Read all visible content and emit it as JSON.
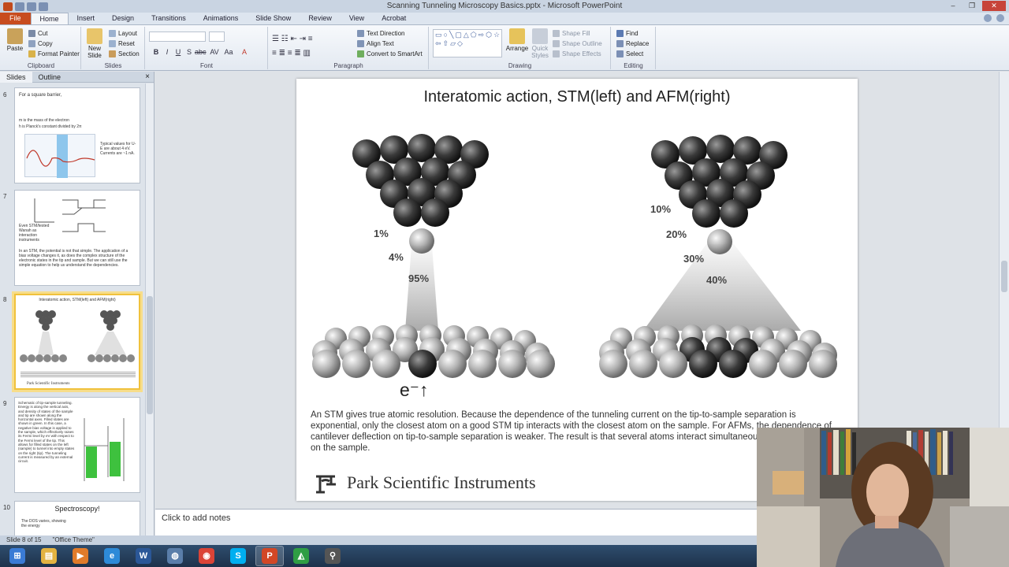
{
  "window": {
    "title": "Scanning Tunneling Microscopy Basics.pptx - Microsoft PowerPoint",
    "controls": [
      "–",
      "❐",
      "✕"
    ]
  },
  "ribbon_tabs": [
    "File",
    "Home",
    "Insert",
    "Design",
    "Transitions",
    "Animations",
    "Slide Show",
    "Review",
    "View",
    "Acrobat"
  ],
  "ribbon": {
    "clipboard": {
      "paste": "Paste",
      "cut": "Cut",
      "copy": "Copy",
      "format_painter": "Format Painter",
      "label": "Clipboard"
    },
    "slides": {
      "new_slide": "New Slide",
      "layout": "Layout",
      "reset": "Reset",
      "section": "Section",
      "label": "Slides"
    },
    "font": {
      "label": "Font",
      "buttons": [
        "B",
        "I",
        "U",
        "S",
        "abc",
        "AV",
        "Aa",
        "A"
      ]
    },
    "paragraph": {
      "label": "Paragraph",
      "text_direction": "Text Direction",
      "align_text": "Align Text",
      "smartart": "Convert to SmartArt"
    },
    "drawing": {
      "label": "Drawing",
      "arrange": "Arrange",
      "quick_styles": "Quick Styles",
      "shape_fill": "Shape Fill",
      "shape_outline": "Shape Outline",
      "shape_effects": "Shape Effects"
    },
    "editing": {
      "label": "Editing",
      "find": "Find",
      "replace": "Replace",
      "select": "Select"
    }
  },
  "panel": {
    "tabs": [
      "Slides",
      "Outline"
    ],
    "close": "×",
    "slides": [
      {
        "num": "6",
        "lines": [
          "For a square barrier,",
          "m is the mass of the electron",
          "h is Planck's constant divided by 2π",
          "Typical values for U-E are about 4 eV. Currents are ~1 nA."
        ]
      },
      {
        "num": "7",
        "lines": [
          "Even STM/tested Wanah as interaction instruments",
          "In an STM, the potential is not that simple. The application of a bias voltage changes it, as does the complex structure of the electronic states in the tip and sample. But we can still use the simple equation to help us understand the dependencies."
        ]
      },
      {
        "num": "8",
        "lines": [
          "Interatomic action, STM(left) and AFM(right)",
          "Park Scientific Instruments"
        ]
      },
      {
        "num": "9",
        "lines": [
          "Schematic of tip-sample tunneling. Energy is along the vertical axis, and density of states of the sample and tip are shown along the horizontal axes. Filled states are shown in green. In this case, a negative bias voltage is applied to the sample, which effectively raises its Fermi level by eV with respect to the Fermi level of the tip. This allows for filled states on the left (sample) to tunnel into empty states on the right (tip). The tunneling current is measured by an external circuit."
        ]
      },
      {
        "num": "10",
        "lines": [
          "Spectroscopy!",
          "The DOS varies, showing the energy"
        ]
      }
    ]
  },
  "slide": {
    "title": "Interatomic action, STM(left) and AFM(right)",
    "stm_percents": [
      "1%",
      "4%",
      "95%"
    ],
    "afm_percents": [
      "10%",
      "20%",
      "30%",
      "40%"
    ],
    "electron_label": "e⁻↑",
    "caption": "An STM gives true atomic resolution.  Because the dependence of the tunneling current on the tip-to-sample separation is exponential, only the closest atom on a good STM tip interacts with the closest atom on the sample.  For AFMs, the dependence of cantilever deflection on tip-to-sample separation is weaker.  The result is that several atoms interact simultaneously with several atoms on the sample.",
    "logo": "Park Scientific Instruments"
  },
  "notes": {
    "placeholder": "Click to add notes"
  },
  "status": {
    "slide": "Slide 8 of 15",
    "theme": "\"Office Theme\""
  },
  "taskbar": {
    "items": [
      {
        "name": "start",
        "glyph": "⊞",
        "color": "#3a7bd5"
      },
      {
        "name": "explorer",
        "glyph": "▤",
        "color": "#e3b341"
      },
      {
        "name": "media",
        "glyph": "▶",
        "color": "#e07b2a"
      },
      {
        "name": "ie",
        "glyph": "e",
        "color": "#2d8ad8"
      },
      {
        "name": "word",
        "glyph": "W",
        "color": "#2b5797"
      },
      {
        "name": "network",
        "glyph": "◍",
        "color": "#5a7eaa"
      },
      {
        "name": "chrome",
        "glyph": "◉",
        "color": "#db4437"
      },
      {
        "name": "skype",
        "glyph": "S",
        "color": "#00aff0"
      },
      {
        "name": "powerpoint",
        "glyph": "P",
        "color": "#d24726"
      },
      {
        "name": "sigma",
        "glyph": "◭",
        "color": "#2f9e44"
      },
      {
        "name": "search",
        "glyph": "⚲",
        "color": "#555"
      }
    ]
  }
}
